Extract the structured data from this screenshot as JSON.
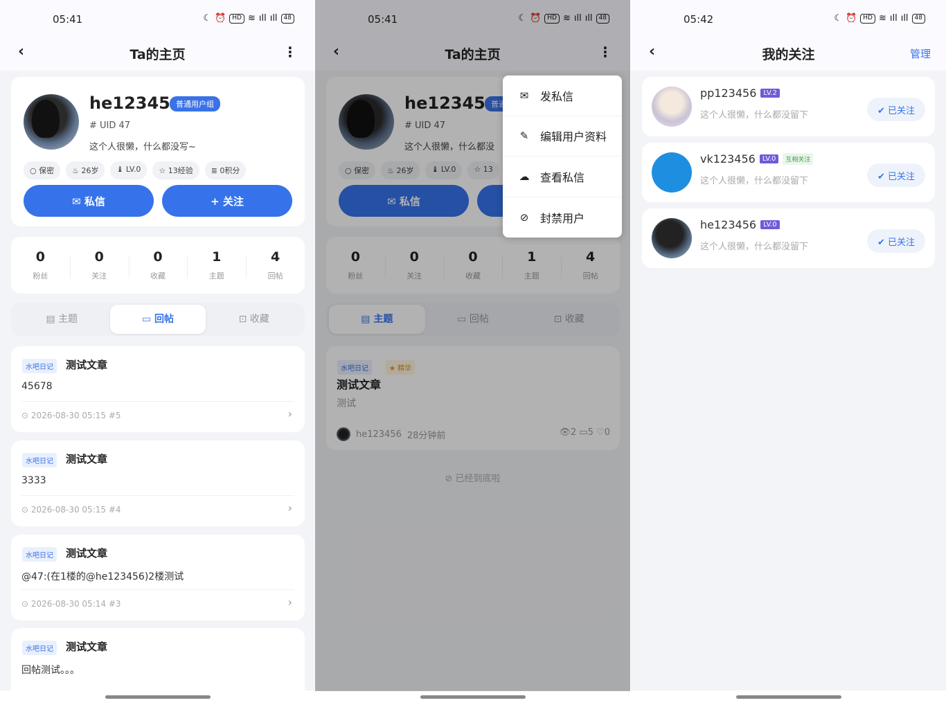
{
  "status": {
    "time1": "05:41",
    "time2": "05:41",
    "time3": "05:42",
    "battery": "48",
    "hd": "HD"
  },
  "screen1": {
    "title": "Ta的主页",
    "back_icon": "chevron-left-icon",
    "more_icon": "more-vertical-icon",
    "user": {
      "name": "he123456",
      "group": "普通用户组",
      "uid": "# UID 47",
      "bio": "这个人很懒，什么都没写~",
      "chips": [
        "○ 保密",
        "♨ 26岁",
        "♝ LV.0",
        "☆ 13经验",
        "≣ 0积分"
      ]
    },
    "buttons": {
      "message": "✉ 私信",
      "follow": "+ 关注"
    },
    "stats": [
      {
        "num": "0",
        "label": "粉丝"
      },
      {
        "num": "0",
        "label": "关注"
      },
      {
        "num": "0",
        "label": "收藏"
      },
      {
        "num": "1",
        "label": "主题"
      },
      {
        "num": "4",
        "label": "回帖"
      }
    ],
    "tabs": [
      "▤ 主题",
      "▭ 回帖",
      "⊡ 收藏"
    ],
    "posts": [
      {
        "tag": "水吧日记",
        "title": "测试文章",
        "body": "45678",
        "meta": "⊙ 2026-08-30 05:15   #5"
      },
      {
        "tag": "水吧日记",
        "title": "测试文章",
        "body": "3333",
        "meta": "⊙ 2026-08-30 05:15   #4"
      },
      {
        "tag": "水吧日记",
        "title": "测试文章",
        "body": "@47:(在1楼的@he123456)2楼测试",
        "meta": "⊙ 2026-08-30 05:14   #3"
      },
      {
        "tag": "水吧日记",
        "title": "测试文章",
        "body": "回帖测试。。。",
        "meta": ""
      }
    ]
  },
  "screen2": {
    "title": "Ta的主页",
    "menu": [
      {
        "icon": "✉",
        "label": "发私信"
      },
      {
        "icon": "✎",
        "label": "编辑用户资料"
      },
      {
        "icon": "☁",
        "label": "查看私信"
      },
      {
        "icon": "⊘",
        "label": "封禁用户"
      }
    ],
    "user": {
      "name": "he123456",
      "badge": "普通",
      "uid": "# UID 47",
      "bio": "这个人很懒，什么都没",
      "chips": [
        "○ 保密",
        "♨ 26岁",
        "♝ LV.0",
        "☆ 13"
      ]
    },
    "buttons": {
      "message": "✉ 私信"
    },
    "stats": [
      {
        "num": "0",
        "label": "粉丝"
      },
      {
        "num": "0",
        "label": "关注"
      },
      {
        "num": "0",
        "label": "收藏"
      },
      {
        "num": "1",
        "label": "主题"
      },
      {
        "num": "4",
        "label": "回帖"
      }
    ],
    "tabs": [
      "▤ 主题",
      "▭ 回帖",
      "⊡ 收藏"
    ],
    "topic": {
      "tag": "水吧日记",
      "tag2": "★ 精华",
      "title": "测试文章",
      "body": "测试",
      "author": "he123456",
      "time": "28分钟前",
      "stats": "👁2   ▭5   ♡0"
    },
    "end": "⊘ 已经到底啦"
  },
  "screen3": {
    "title": "我的关注",
    "manage": "管理",
    "follows": [
      {
        "name": "pp123456",
        "lv": "LV.2",
        "mutual": "",
        "bio": "这个人很懒，什么都没留下",
        "btn": "✔ 已关注"
      },
      {
        "name": "vk123456",
        "lv": "LV.0",
        "mutual": "互相关注",
        "bio": "这个人很懒，什么都没留下",
        "btn": "✔ 已关注"
      },
      {
        "name": "he123456",
        "lv": "LV.0",
        "mutual": "",
        "bio": "这个人很懒，什么都没留下",
        "btn": "✔ 已关注"
      }
    ]
  }
}
